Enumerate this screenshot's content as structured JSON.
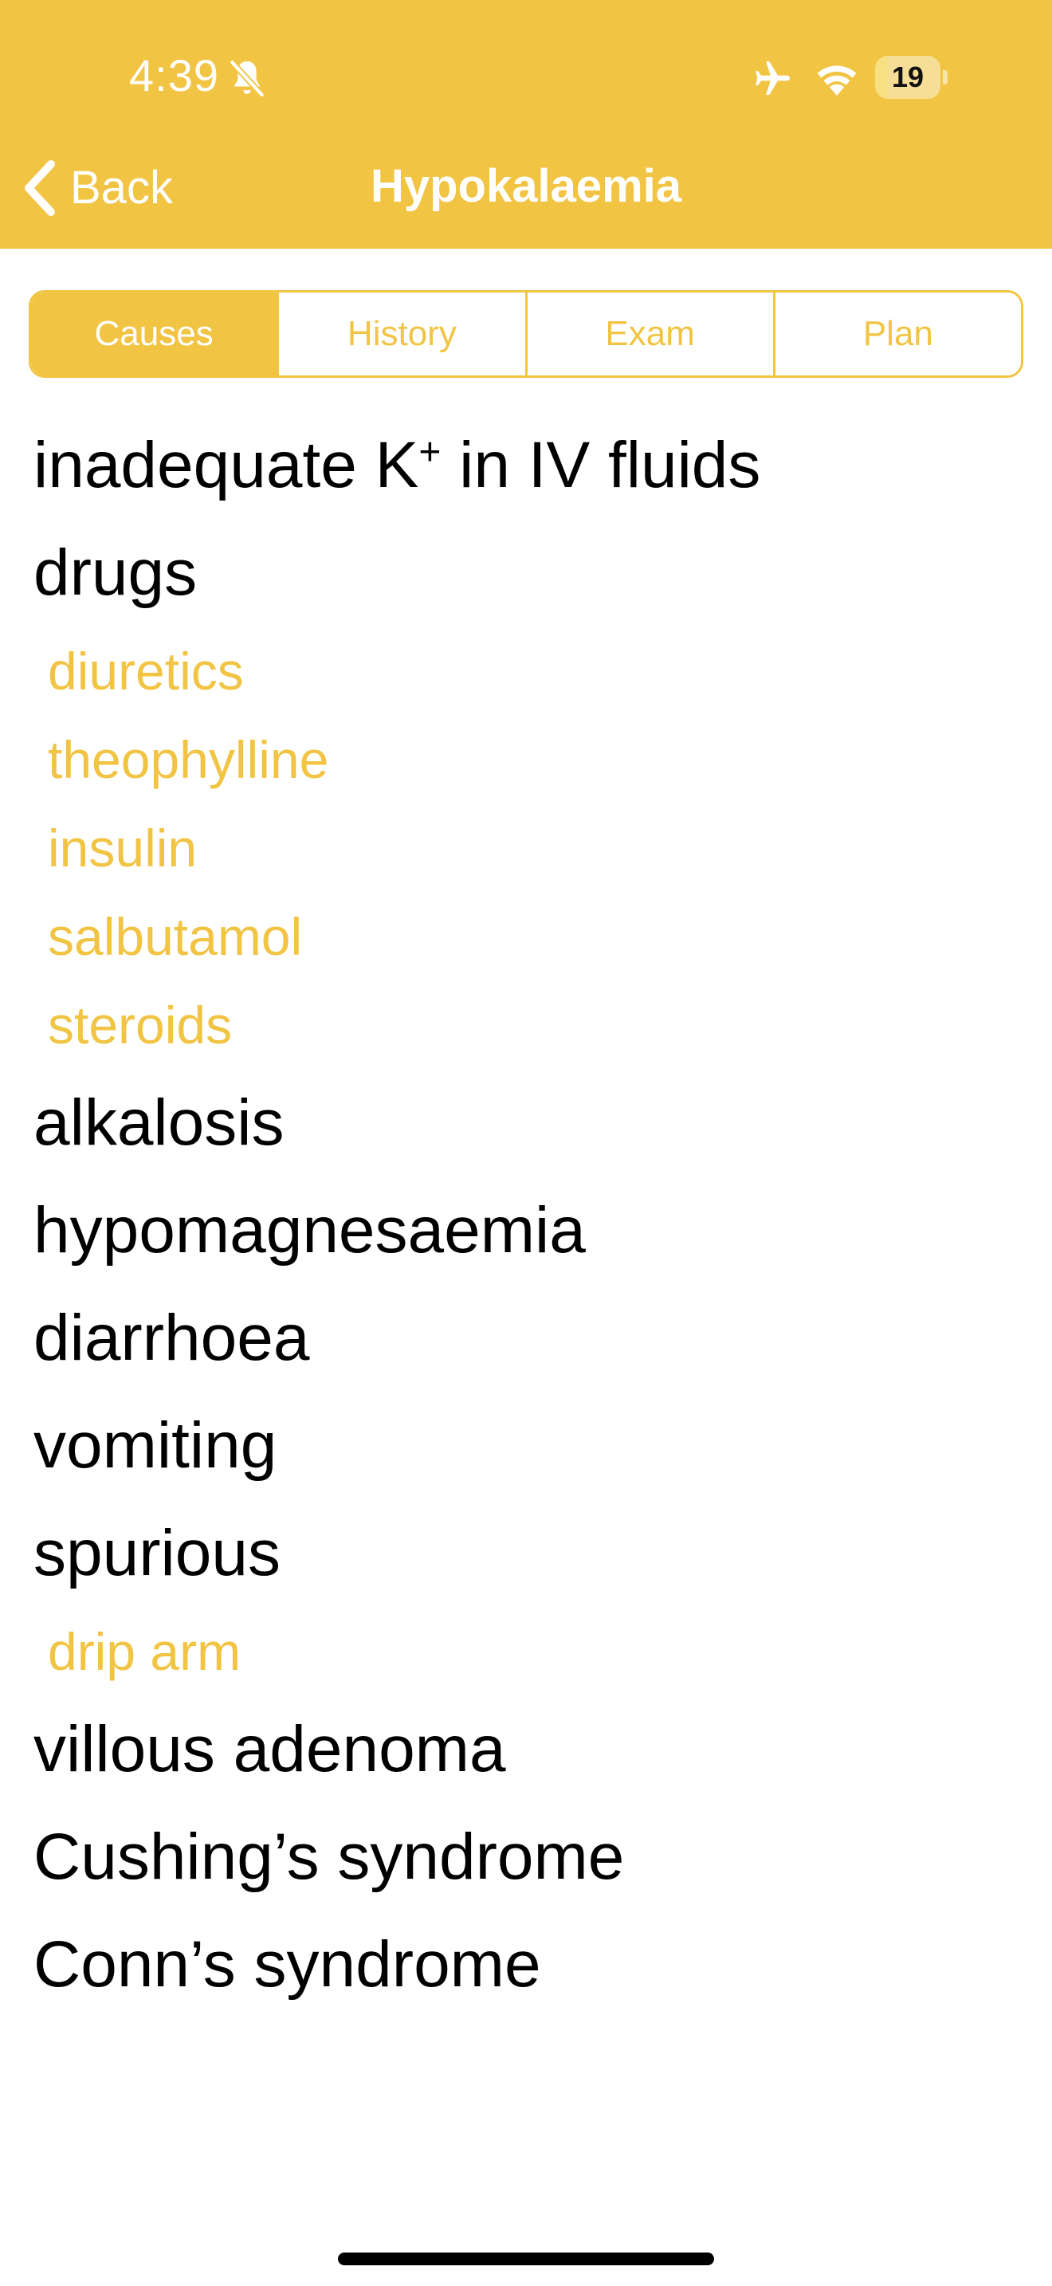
{
  "status_bar": {
    "time": "4:39",
    "battery_level": "19",
    "battery_fraction": 0.19,
    "icons": [
      "bell-slash-icon",
      "airplane-icon",
      "wifi-icon",
      "battery-icon"
    ]
  },
  "nav": {
    "back_label": "Back",
    "title": "Hypokalaemia"
  },
  "tabs": [
    {
      "label": "Causes",
      "selected": true
    },
    {
      "label": "History",
      "selected": false
    },
    {
      "label": "Exam",
      "selected": false
    },
    {
      "label": "Plan",
      "selected": false
    }
  ],
  "causes": [
    {
      "kind": "main",
      "text": "inadequate K",
      "superscript": "+",
      "text_after": " in IV fluids"
    },
    {
      "kind": "main",
      "text": "drugs"
    },
    {
      "kind": "sub",
      "text": "diuretics"
    },
    {
      "kind": "sub",
      "text": "theophylline"
    },
    {
      "kind": "sub",
      "text": "insulin"
    },
    {
      "kind": "sub",
      "text": "salbutamol"
    },
    {
      "kind": "sub",
      "text": "steroids"
    },
    {
      "kind": "main",
      "text": "alkalosis"
    },
    {
      "kind": "main",
      "text": "hypomagnesaemia"
    },
    {
      "kind": "main",
      "text": "diarrhoea"
    },
    {
      "kind": "main",
      "text": "vomiting"
    },
    {
      "kind": "main",
      "text": "spurious"
    },
    {
      "kind": "sub",
      "text": "drip arm"
    },
    {
      "kind": "main",
      "text": "villous adenoma"
    },
    {
      "kind": "main",
      "text": "Cushing’s syndrome"
    },
    {
      "kind": "main",
      "text": "Conn’s syndrome"
    }
  ],
  "colors": {
    "accent": "#f1c443",
    "text": "#000000",
    "background": "#ffffff"
  }
}
